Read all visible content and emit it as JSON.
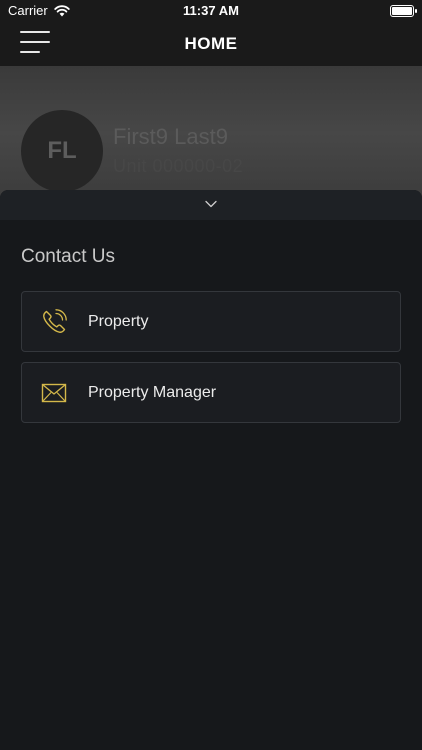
{
  "status_bar": {
    "carrier": "Carrier",
    "time": "11:37 AM",
    "wifi_icon": "wifi-icon",
    "battery_icon": "battery-icon"
  },
  "nav": {
    "title": "HOME",
    "menu_icon": "hamburger-menu-icon"
  },
  "profile": {
    "initials": "FL",
    "name": "First9 Last9",
    "subtitle": "Unit 000000-02"
  },
  "sheet": {
    "collapse_icon": "chevron-down-icon",
    "section_title": "Contact Us",
    "contacts": [
      {
        "label": "Property",
        "icon": "phone-icon"
      },
      {
        "label": "Property Manager",
        "icon": "mail-icon"
      }
    ]
  },
  "colors": {
    "accent": "#d4b84a",
    "background": "#16181b",
    "card_border": "#34373c"
  }
}
